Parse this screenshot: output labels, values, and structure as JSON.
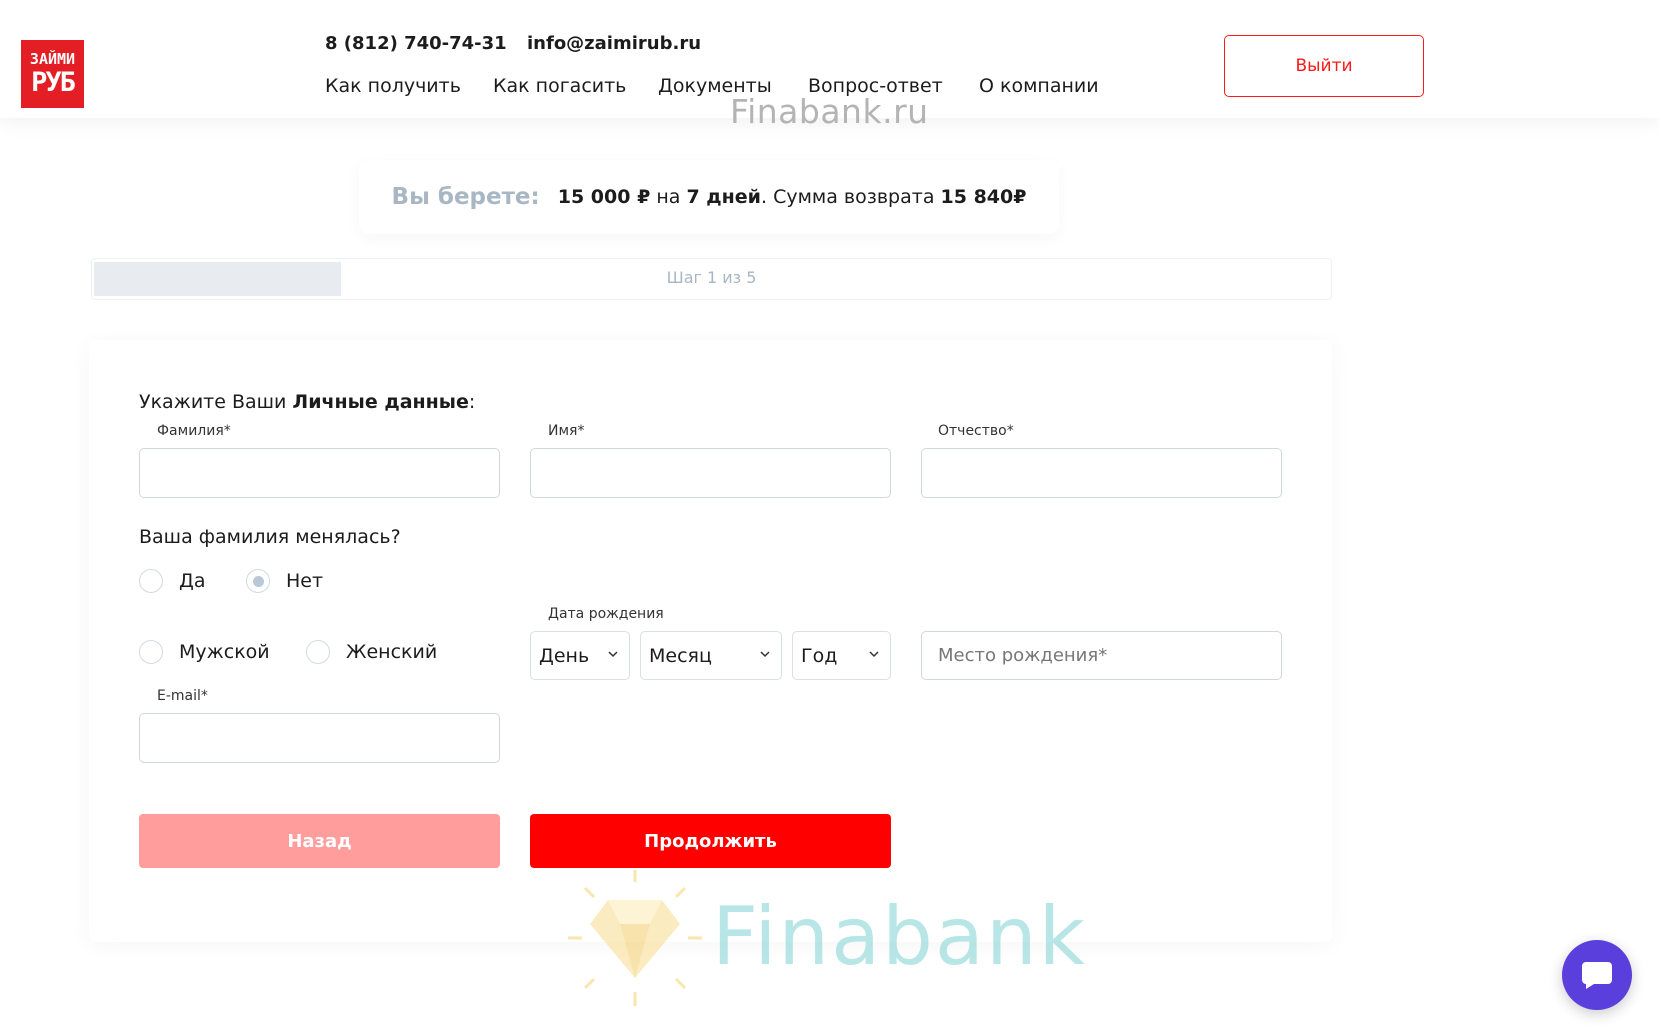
{
  "header": {
    "logo_line1": "ЗАЙМИ",
    "logo_line2": "РУБ",
    "phone": "8 (812) 740-74-31",
    "email": "info@zaimirub.ru",
    "nav": [
      "Как получить",
      "Как погасить",
      "Документы",
      "Вопрос-ответ",
      "О компании"
    ],
    "logout_label": "Выйти"
  },
  "watermark_top": "Finabank.ru",
  "summary": {
    "label": "Вы берете:",
    "amount": "15 000 ₽",
    "on": "на",
    "days": "7 дней",
    "return_text": ". Сумма возврата",
    "return_amount": "15 840₽"
  },
  "progress": {
    "text": "Шаг 1 из 5",
    "fraction": 0.2
  },
  "form": {
    "heading_prefix": "Укажите Ваши",
    "heading_bold": "Личные данные",
    "heading_suffix": ":",
    "last_name_label": "Фамилия*",
    "first_name_label": "Имя*",
    "middle_name_label": "Отчество*",
    "surname_changed_question": "Ваша фамилия менялась?",
    "yes_label": "Да",
    "no_label": "Нет",
    "surname_changed_value": "Нет",
    "male_label": "Мужской",
    "female_label": "Женский",
    "dob_label": "Дата рождения",
    "day_label": "День",
    "month_label": "Месяц",
    "year_label": "Год",
    "birthplace_placeholder": "Место рождения*",
    "email_label": "E-mail*",
    "back_label": "Назад",
    "continue_label": "Продолжить"
  },
  "watermark_bottom": "Finabank",
  "colors": {
    "accent": "#ff0000",
    "accent_light": "#ff9d9d",
    "muted": "#a9b6c4",
    "chat": "#5b3fdc"
  },
  "icons": {
    "chat": "chat-bubble-icon",
    "select": "chevron-down-icon",
    "watermark": "diamond-icon"
  }
}
